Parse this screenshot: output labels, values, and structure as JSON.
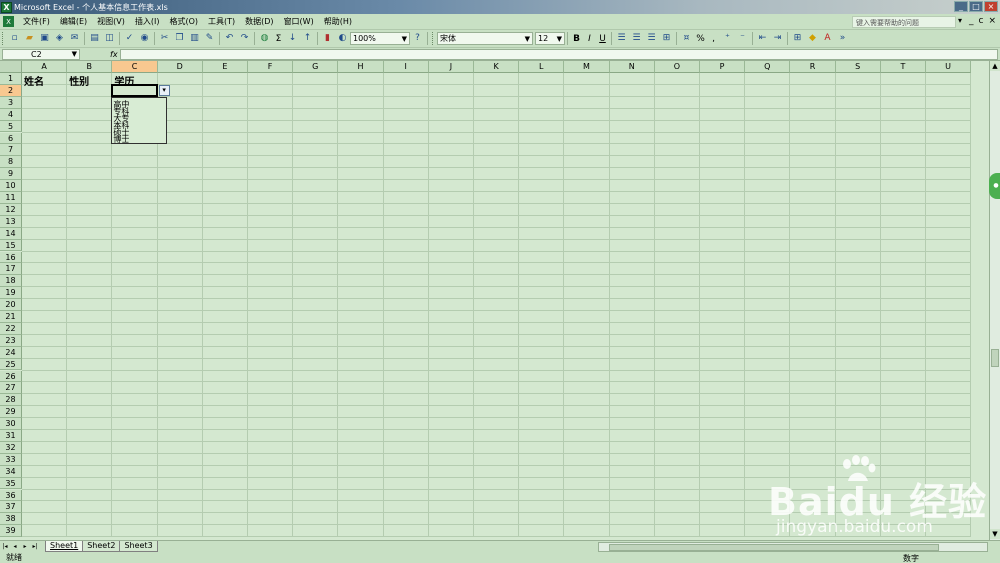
{
  "window": {
    "title": "Microsoft Excel - 个人基本信息工作表.xls",
    "app_icon": "excel-icon",
    "buttons": [
      "_",
      "□",
      "×"
    ]
  },
  "menubar": {
    "items": [
      "文件(F)",
      "编辑(E)",
      "视图(V)",
      "插入(I)",
      "格式(O)",
      "工具(T)",
      "数据(D)",
      "窗口(W)",
      "帮助(H)"
    ],
    "help_placeholder": "键入需要帮助的问题",
    "doc_buttons": [
      "_",
      "ⅽ",
      "×"
    ]
  },
  "toolbar": {
    "zoom": "100%",
    "font_name": "宋体",
    "font_size": "12",
    "bold": "B",
    "italic": "I",
    "underline": "U",
    "percent": "%",
    "comma": ",",
    "sigma": "Σ"
  },
  "formula_bar": {
    "name_box": "C2",
    "fx": "fx",
    "formula": ""
  },
  "grid": {
    "columns": [
      "A",
      "B",
      "C",
      "D",
      "E",
      "F",
      "G",
      "H",
      "I",
      "J",
      "K",
      "L",
      "M",
      "N",
      "O",
      "P",
      "Q",
      "R",
      "S",
      "T",
      "U"
    ],
    "active_column": "C",
    "rows": [
      "1",
      "2",
      "3",
      "4",
      "5",
      "6",
      "7",
      "8",
      "9",
      "10",
      "11",
      "12",
      "13",
      "14",
      "15",
      "16",
      "17",
      "18",
      "19",
      "20",
      "21",
      "22",
      "23",
      "24",
      "25",
      "26",
      "27",
      "28",
      "29",
      "30",
      "31",
      "32",
      "33",
      "34",
      "35",
      "36",
      "37",
      "38",
      "39"
    ],
    "active_row": "2",
    "cells": {
      "A1": "姓名",
      "B1": "性别",
      "C1": "学历"
    },
    "dropdown_arrow": "▾",
    "dropdown_options": [
      "高中",
      "专科",
      "大专",
      "本科",
      "硕士",
      "博士"
    ]
  },
  "sheets": {
    "tabs": [
      "Sheet1",
      "Sheet2",
      "Sheet3"
    ],
    "active": "Sheet1",
    "nav": [
      "|◂",
      "◂",
      "▸",
      "▸|"
    ]
  },
  "status": {
    "left": "就绪",
    "right": "数字"
  },
  "watermark": {
    "logo": "Bai",
    "logo_tail": "du 经验",
    "url": "jingyan.baidu.com"
  },
  "colors": {
    "sheet_bg": "#d4e8d0",
    "chrome_bg": "#c8e0c4",
    "active_header": "#f8c890",
    "grid_line": "#b4ccb0"
  }
}
